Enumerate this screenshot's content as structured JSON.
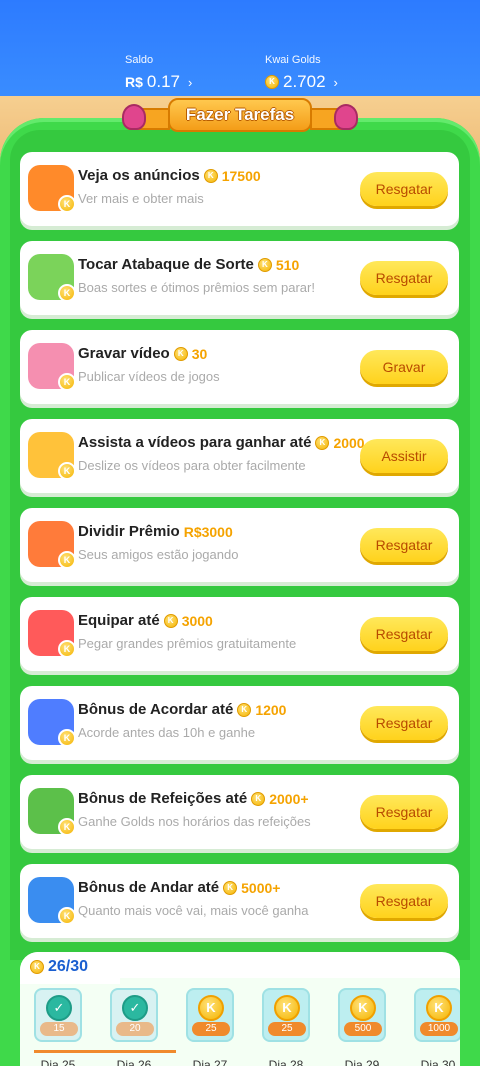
{
  "header": {
    "saldo_label": "Saldo",
    "saldo_currency": "R$",
    "saldo_value": "0.17",
    "golds_label": "Kwai Golds",
    "golds_value": "2.702",
    "chevron": "›"
  },
  "banner": {
    "title": "Fazer Tarefas"
  },
  "coin_letter": "K",
  "tasks": [
    {
      "title": "Veja os anúncios",
      "reward": "17500",
      "reward_has_coin": true,
      "subtitle": "Ver mais e obter mais",
      "button": "Resgatar",
      "icon": "tv-icon",
      "icon_color": "#ff8a2a"
    },
    {
      "title": "Tocar Atabaque de Sorte",
      "reward": "510",
      "reward_has_coin": true,
      "subtitle": "Boas sortes e ótimos prêmios sem parar!",
      "button": "Resgatar",
      "icon": "drum-icon",
      "icon_color": "#7bd35a"
    },
    {
      "title": "Gravar vídeo",
      "reward": "30",
      "reward_has_coin": true,
      "subtitle": "Publicar vídeos de jogos",
      "button": "Gravar",
      "icon": "record-icon",
      "icon_color": "#f58fb0"
    },
    {
      "title": "Assista a vídeos para ganhar até",
      "reward": "2000",
      "reward_has_coin": true,
      "subtitle": "Deslize os vídeos para obter facilmente",
      "button": "Assistir",
      "icon": "camera-icon",
      "icon_color": "#ffc23a"
    },
    {
      "title": "Dividir Prêmio",
      "reward": "R$3000",
      "reward_has_coin": false,
      "subtitle": "Seus amigos estão jogando",
      "button": "Resgatar",
      "icon": "gift-icon",
      "icon_color": "#ff7b3a"
    },
    {
      "title": "Equipar até",
      "reward": "3000",
      "reward_has_coin": true,
      "subtitle": "Pegar grandes prêmios gratuitamente",
      "button": "Resgatar",
      "icon": "glove-icon",
      "icon_color": "#ff5a5a"
    },
    {
      "title": "Bônus de Acordar até",
      "reward": "1200",
      "reward_has_coin": true,
      "subtitle": "Acorde antes das 10h e ganhe",
      "button": "Resgatar",
      "icon": "moon-icon",
      "icon_color": "#4f7dff"
    },
    {
      "title": "Bônus de Refeições até",
      "reward": "2000+",
      "reward_has_coin": true,
      "subtitle": "Ganhe Golds nos horários das refeições",
      "button": "Resgatar",
      "icon": "calendar-icon",
      "icon_color": "#5cc04a"
    },
    {
      "title": "Bônus de Andar até",
      "reward": "5000+",
      "reward_has_coin": true,
      "subtitle": "Quanto mais você vai, mais você ganha",
      "button": "Resgatar",
      "icon": "walker-icon",
      "icon_color": "#3a8df0"
    }
  ],
  "checkin": {
    "progress": "26/30",
    "check_mark": "✓",
    "days": [
      {
        "amount": "15",
        "label": "Dia 25",
        "done": true
      },
      {
        "amount": "20",
        "label": "Dia 26",
        "done": true
      },
      {
        "amount": "25",
        "label": "Dia 27",
        "done": false
      },
      {
        "amount": "25",
        "label": "Dia 28",
        "done": false
      },
      {
        "amount": "500",
        "label": "Dia 29",
        "done": false
      },
      {
        "amount": "1000",
        "label": "Dia 30",
        "done": false
      }
    ]
  }
}
